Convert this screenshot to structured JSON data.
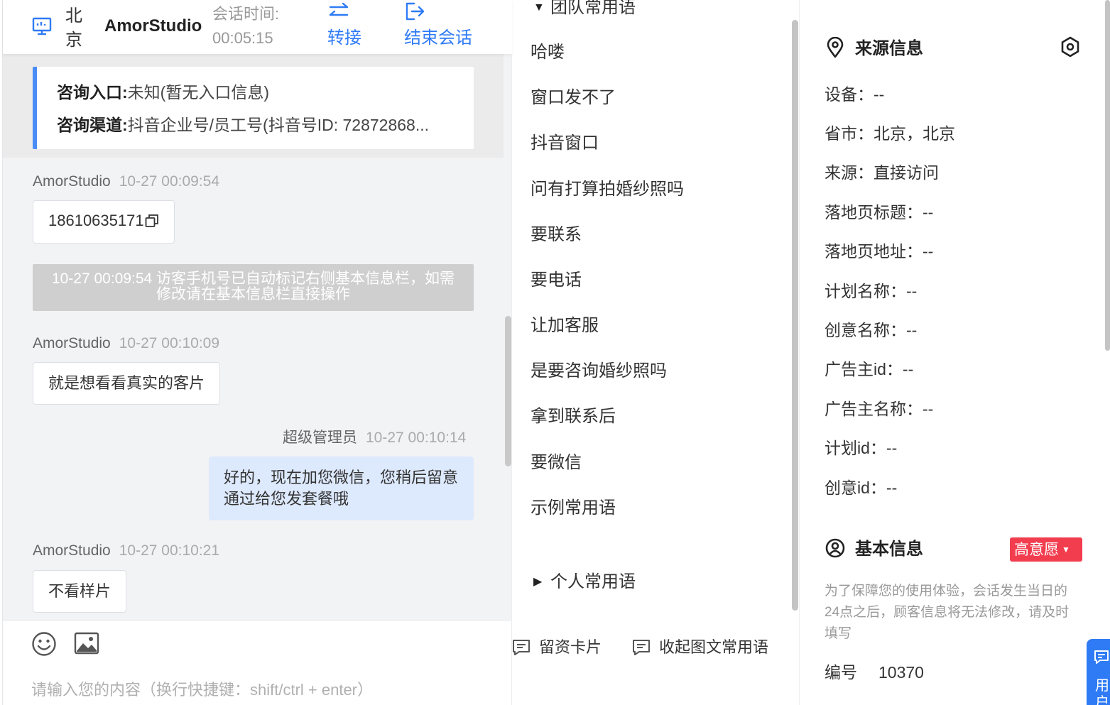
{
  "header": {
    "city": "北京",
    "visitor": "AmorStudio",
    "time_label": "会话时间:",
    "time_value": "00:05:15",
    "transfer": "转接",
    "end": "结束会话"
  },
  "entry": {
    "entrance_label": "咨询入口:",
    "entrance_value": "未知(暂无入口信息)",
    "channel_label": "咨询渠道:",
    "channel_value": "抖音企业号/员工号(抖音号ID: 72872868..."
  },
  "messages": [
    {
      "sender": "AmorStudio",
      "time": "10-27 00:09:54",
      "text": "18610635171"
    },
    {
      "sender": "AmorStudio",
      "time": "10-27 00:10:09",
      "text": "就是想看看真实的客片"
    },
    {
      "sender": "超级管理员",
      "time": "10-27 00:10:14",
      "text": "好的，现在加您微信，您稍后留意通过给您发套餐哦"
    },
    {
      "sender": "AmorStudio",
      "time": "10-27 00:10:21",
      "text": "不看样片"
    }
  ],
  "system_note": "10-27 00:09:54 访客手机号已自动标记右侧基本信息栏，如需修改请在基本信息栏直接操作",
  "composer": {
    "placeholder": "请输入您的内容（换行快捷键：shift/ctrl + enter）",
    "value": ""
  },
  "quick": {
    "team_group": "团队常用语",
    "phrases": [
      "哈喽",
      "窗口发不了",
      "抖音窗口",
      "问有打算拍婚纱照吗",
      "要联系",
      "要电话",
      "让加客服",
      "是要咨询婚纱照吗",
      "拿到联系后",
      "要微信",
      "示例常用语"
    ],
    "personal_group": "个人常用语",
    "card_button": "留资卡片",
    "collapse_button": "收起图文常用语"
  },
  "info": {
    "source_title": "来源信息",
    "fields": [
      {
        "label": "设备",
        "value": "--"
      },
      {
        "label": "省市",
        "value": "北京，北京"
      },
      {
        "label": "来源",
        "value": "直接访问"
      },
      {
        "label": "落地页标题",
        "value": "--"
      },
      {
        "label": "落地页地址",
        "value": "--"
      },
      {
        "label": "计划名称",
        "value": "--"
      },
      {
        "label": "创意名称",
        "value": "--"
      },
      {
        "label": "广告主id",
        "value": "--"
      },
      {
        "label": "广告主名称",
        "value": "--"
      },
      {
        "label": "计划id",
        "value": "--"
      },
      {
        "label": "创意id",
        "value": "--"
      }
    ],
    "basic_title": "基本信息",
    "intent_tag": "高意愿",
    "notice": "为了保障您的使用体验，会话发生当日的24点之后，顾客信息将无法修改，请及时填写",
    "serial_label": "编号",
    "serial_value": "10370"
  },
  "float_button": "用户",
  "colors": {
    "accent": "#2f7bf5",
    "tag_red": "#f23d4f",
    "my_bubble": "#dde9fc",
    "system_note_bg": "#cfcfcf"
  },
  "icons": [
    "monitor-icon",
    "transfer-icon",
    "exit-icon",
    "copy-icon",
    "emoji-icon",
    "image-icon",
    "card-icon",
    "chat-icon",
    "location-pin-icon",
    "settings-icon",
    "user-circle-icon",
    "feedback-icon"
  ]
}
